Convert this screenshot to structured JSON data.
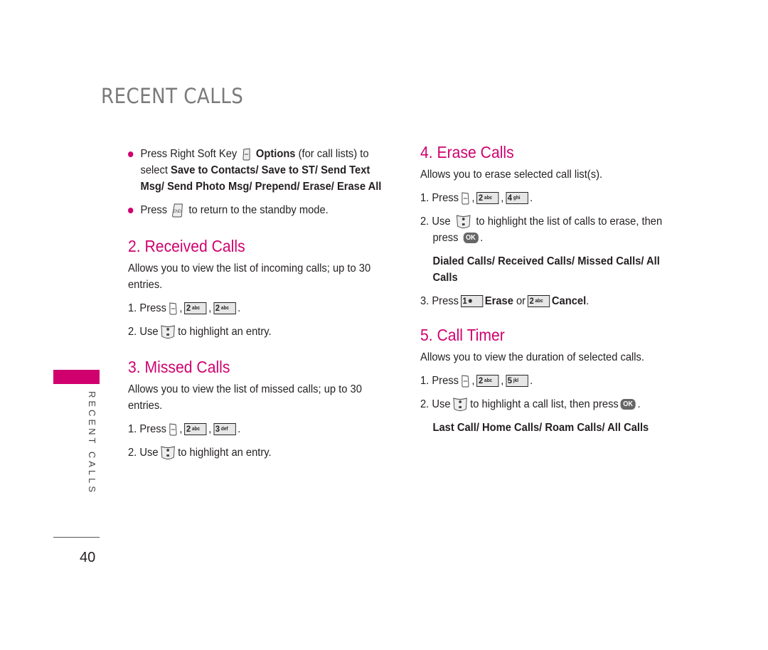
{
  "page": {
    "title": "RECENT CALLS",
    "side_tab": "RECENT CALLS",
    "page_number": "40",
    "accent_color": "#d0006f"
  },
  "intro": {
    "bullet1": {
      "pre": "Press Right Soft Key",
      "icon": "right-soft-key-icon",
      "bold1": "Options",
      "mid": "(for call lists) to",
      "line2_pre": "select",
      "options": "Save to Contacts/ Save to ST/ Send Text",
      "options_line3": "Msg/ Send Photo Msg/ Prepend/ Erase/ Erase All"
    },
    "bullet2": {
      "pre": "Press",
      "icon": "end-key-icon",
      "post": "to return to the standby mode."
    }
  },
  "sections": {
    "received": {
      "heading": "2. Received Calls",
      "desc_line1": "Allows you to view the list of incoming calls; up to 30",
      "desc_line2": "entries.",
      "step1_pre": "1. Press",
      "step1_keys": [
        "2",
        "2"
      ],
      "step1_keys_sub": [
        "abc",
        "abc"
      ],
      "step2_pre": "2. Use",
      "step2_post": "to highlight an entry."
    },
    "missed": {
      "heading": "3. Missed Calls",
      "desc_line1": "Allows you to view the list of missed calls; up to 30",
      "desc_line2": "entries.",
      "step1_pre": "1. Press",
      "step1_keys": [
        "2",
        "3"
      ],
      "step1_keys_sub": [
        "abc",
        "def"
      ],
      "step2_pre": "2. Use",
      "step2_post": "to highlight an entry."
    },
    "erase": {
      "heading": "4. Erase Calls",
      "desc": "Allows you to erase selected call list(s).",
      "step1_pre": "1. Press",
      "step1_keys": [
        "2",
        "4"
      ],
      "step1_keys_sub": [
        "abc",
        "ghi"
      ],
      "step2_pre": "2. Use",
      "step2_post": "to highlight the list of calls to erase, then",
      "step2_line2": "press",
      "ok_label": "OK",
      "options_line1": "Dialed Calls/ Received Calls/ Missed Calls/ All",
      "options_line2": "Calls",
      "step3_pre": "3. Press",
      "step3_key1": "1",
      "step3_bold1": "Erase",
      "step3_or": "or",
      "step3_key2": "2",
      "step3_key2_sub": "abc",
      "step3_bold2": "Cancel",
      "step3_end": "."
    },
    "timer": {
      "heading": "5. Call Timer",
      "desc": "Allows you to view the duration of selected calls.",
      "step1_pre": "1. Press",
      "step1_keys": [
        "2",
        "5"
      ],
      "step1_keys_sub": [
        "abc",
        "jkl"
      ],
      "step2_pre": "2. Use",
      "step2_post": "to highlight a call list, then press",
      "ok_label": "OK",
      "options": "Last Call/ Home Calls/ Roam Calls/ All Calls"
    }
  },
  "punct": {
    "comma": ",",
    "period": "."
  }
}
